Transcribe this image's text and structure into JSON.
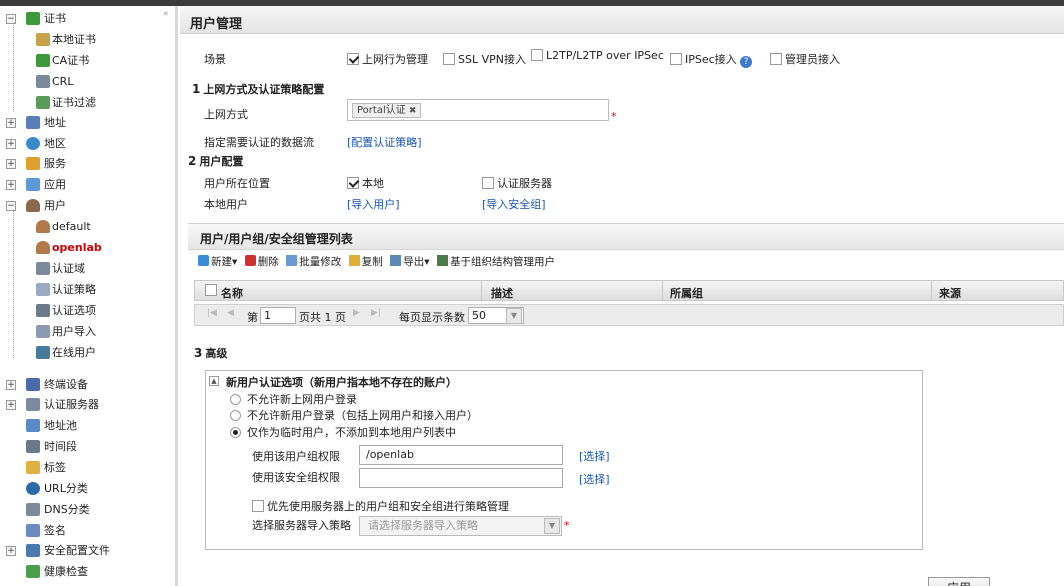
{
  "sidebar": {
    "items": [
      {
        "label": "证书",
        "icon": "certificate-icon"
      },
      {
        "label": "本地证书",
        "icon": "local-cert-icon"
      },
      {
        "label": "CA证书",
        "icon": "ca-cert-icon"
      },
      {
        "label": "CRL",
        "icon": "crl-icon"
      },
      {
        "label": "证书过滤",
        "icon": "cert-filter-icon"
      },
      {
        "label": "地址",
        "icon": "address-icon"
      },
      {
        "label": "地区",
        "icon": "region-icon"
      },
      {
        "label": "服务",
        "icon": "service-icon"
      },
      {
        "label": "应用",
        "icon": "application-icon"
      },
      {
        "label": "用户",
        "icon": "user-icon"
      },
      {
        "label": "default",
        "icon": "user-group-icon"
      },
      {
        "label": "openlab",
        "icon": "user-group-icon"
      },
      {
        "label": "认证域",
        "icon": "auth-domain-icon"
      },
      {
        "label": "认证策略",
        "icon": "auth-policy-icon"
      },
      {
        "label": "认证选项",
        "icon": "auth-option-icon"
      },
      {
        "label": "用户导入",
        "icon": "user-import-icon"
      },
      {
        "label": "在线用户",
        "icon": "online-user-icon"
      },
      {
        "label": "终端设备",
        "icon": "terminal-device-icon"
      },
      {
        "label": "认证服务器",
        "icon": "auth-server-icon"
      },
      {
        "label": "地址池",
        "icon": "address-pool-icon"
      },
      {
        "label": "时间段",
        "icon": "time-range-icon"
      },
      {
        "label": "标签",
        "icon": "tag-icon"
      },
      {
        "label": "URL分类",
        "icon": "url-category-icon"
      },
      {
        "label": "DNS分类",
        "icon": "dns-category-icon"
      },
      {
        "label": "签名",
        "icon": "signature-icon"
      },
      {
        "label": "安全配置文件",
        "icon": "security-profile-icon"
      },
      {
        "label": "健康检查",
        "icon": "health-check-icon"
      }
    ]
  },
  "page": {
    "title": "用户管理"
  },
  "scenario": {
    "label": "场景",
    "options": [
      {
        "label": "上网行为管理",
        "checked": true
      },
      {
        "label": "SSL VPN接入",
        "checked": false
      },
      {
        "label": "L2TP/L2TP over IPSec",
        "checked": false
      },
      {
        "label": "IPSec接入",
        "checked": false
      },
      {
        "label": "管理员接入",
        "checked": false
      }
    ]
  },
  "section1": {
    "num": "1",
    "title": "上网方式及认证策略配置",
    "access_label": "上网方式",
    "access_tag": "Portal认证",
    "tag_remove": "✖",
    "required_mark": "*",
    "flow_label": "指定需要认证的数据流",
    "flow_link": "[配置认证策略]"
  },
  "section2": {
    "num": "2",
    "title": "用户配置",
    "location_label": "用户所在位置",
    "loc_local": "本地",
    "loc_server": "认证服务器",
    "local_user_label": "本地用户",
    "import_users": "[导入用户]",
    "import_groups": "[导入安全组]"
  },
  "list": {
    "title": "用户/用户组/安全组管理列表",
    "toolbar": [
      "新建▾",
      "删除",
      "批量修改",
      "复制",
      "导出▾",
      "基于组织结构管理用户"
    ],
    "columns": [
      "名称",
      "描述",
      "所属组",
      "来源"
    ],
    "pager": {
      "page_prefix": "第",
      "page_value": "1",
      "page_suffix": "页共 1 页",
      "per_page_label": "每页显示条数",
      "per_page_value": "50"
    }
  },
  "section3": {
    "num": "3",
    "title": "高级",
    "box_title": "新用户认证选项（新用户指本地不存在的账户）",
    "radios": [
      {
        "label": "不允许新上网用户登录",
        "checked": false
      },
      {
        "label": "不允许新用户登录（包括上网用户和接入用户）",
        "checked": false
      },
      {
        "label": "仅作为临时用户，不添加到本地用户列表中",
        "checked": true
      }
    ],
    "group_perm_label": "使用该用户组权限",
    "group_perm_value": "/openlab",
    "secgroup_perm_label": "使用该安全组权限",
    "secgroup_perm_value": "",
    "select_link": "[选择]",
    "prefer_server": "优先使用服务器上的用户组和安全组进行策略管理",
    "import_policy_label": "选择服务器导入策略",
    "import_policy_placeholder": "请选择服务器导入策略"
  },
  "apply_label": "应用"
}
